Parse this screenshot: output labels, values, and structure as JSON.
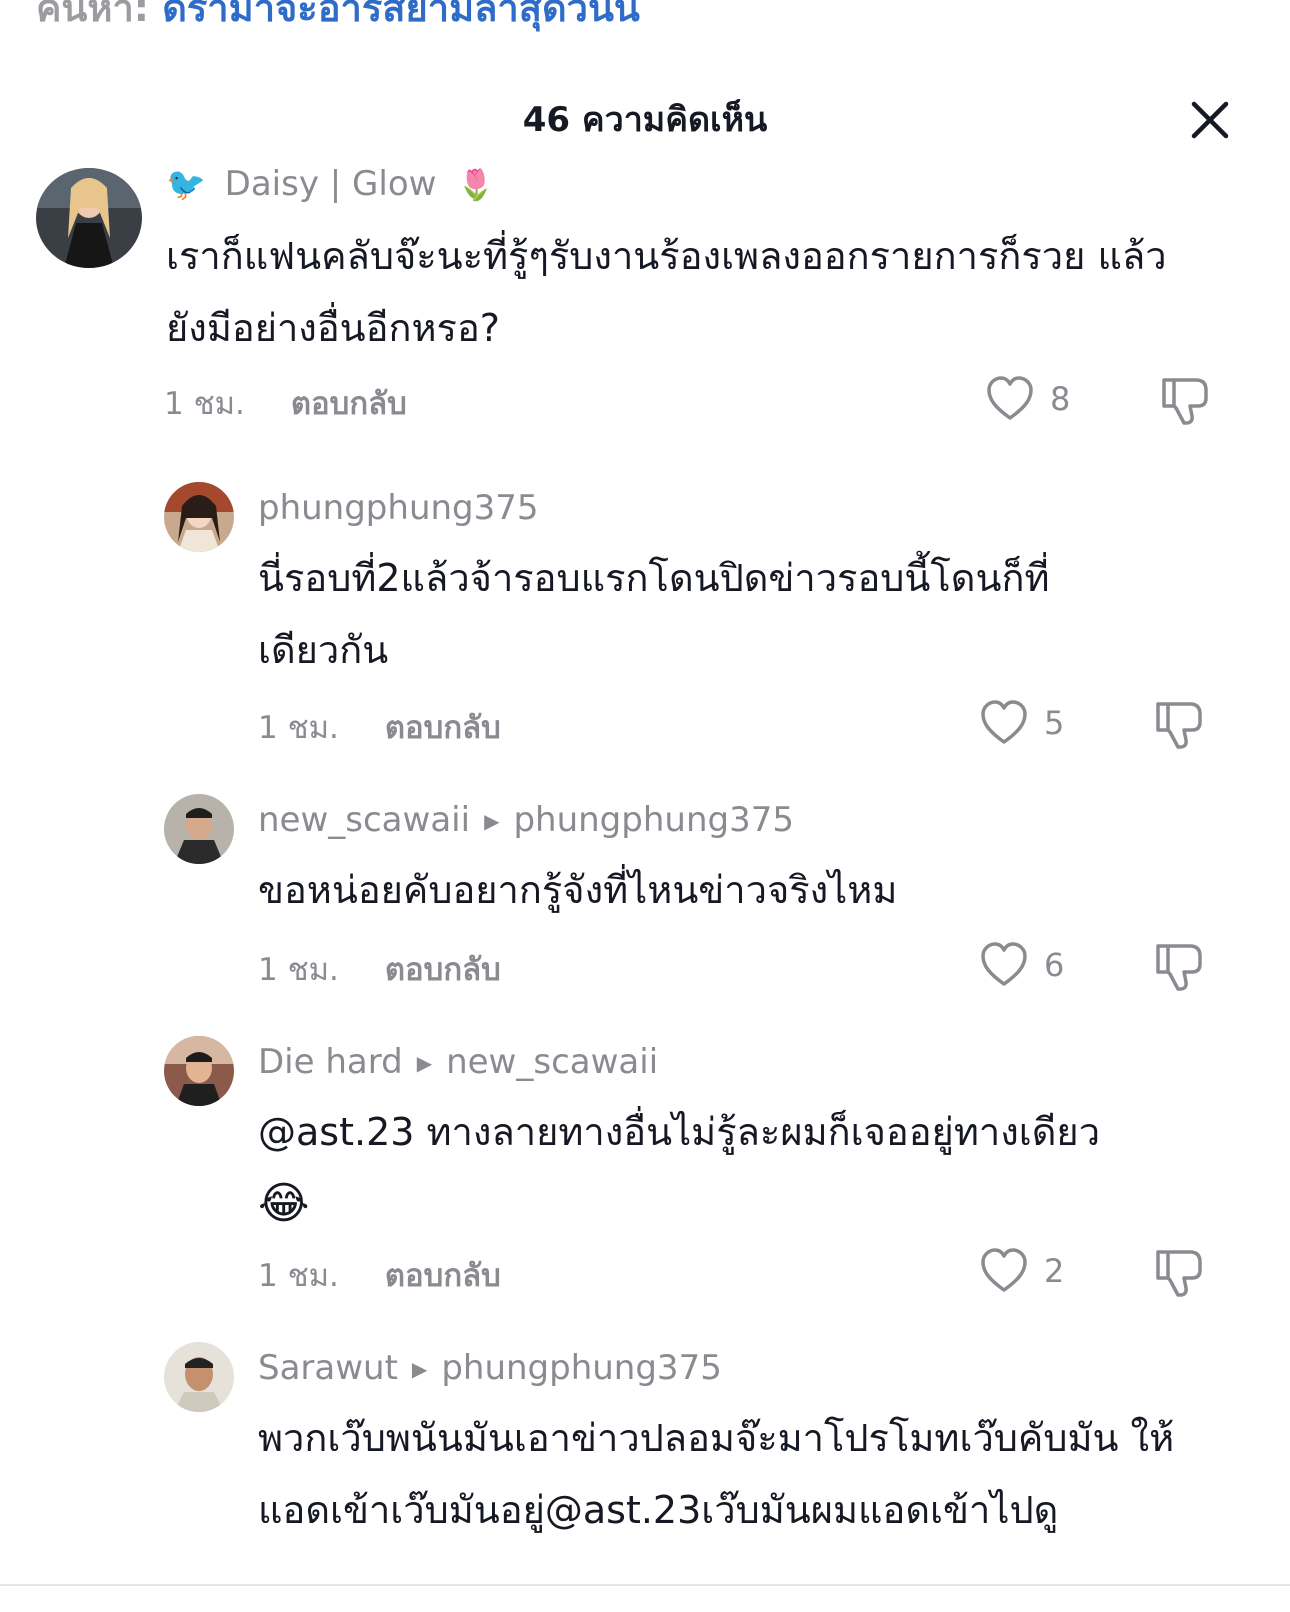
{
  "search": {
    "prefix": "ค้นหา:",
    "query": "ดราม่าจะอ้ารสยามล่าสุดวันนี้"
  },
  "header": {
    "title": "46 ความคิดเห็น"
  },
  "comments": [
    {
      "user": "Daisy | Glow",
      "reply_to": "",
      "text": "เราก็แฟนคลับจ๊ะนะที่รู้ๆรับงานร้องเพลงออกรายการก็รวย แล้วยังมีอย่างอื่นอีกหรอ?",
      "time": "1 ชม.",
      "reply_label": "ตอบกลับ",
      "likes": "8"
    },
    {
      "user": "phungphung375",
      "reply_to": "",
      "text": "นี่รอบที่2แล้วจ้ารอบแรกโดนปิดข่าวรอบนี้โดนก็ที่เดียวกัน",
      "time": "1 ชม.",
      "reply_label": "ตอบกลับ",
      "likes": "5"
    },
    {
      "user": "new_scawaii",
      "reply_to": "phungphung375",
      "text": "ขอหน่อยคับอยากรู้จังที่ไหนข่าวจริงไหม",
      "time": "1 ชม.",
      "reply_label": "ตอบกลับ",
      "likes": "6"
    },
    {
      "user": "Die hard",
      "reply_to": "new_scawaii",
      "mention": "@ast.23",
      "text": " ทางลายทางอื่นไม่รู้ละผมก็เจออยู่ทางเดียว",
      "emoji": "😂",
      "time": "1 ชม.",
      "reply_label": "ตอบกลับ",
      "likes": "2"
    },
    {
      "user": "Sarawut",
      "reply_to": "phungphung375",
      "text": "พวกเว๊บพนันมันเอาข่าวปลอมจ๊ะมาโปรโมทเว๊บคับมัน ให้แอดเข้าเว๊บมันอยู่@ast.23เว๊บมันผมแอดเข้าไปดู"
    }
  ],
  "icons": {
    "close": "close-icon",
    "like": "heart-outline-icon",
    "dislike": "thumbs-down-icon",
    "reply_arrow": "triangle-right-icon"
  },
  "colors": {
    "text": "#161823",
    "muted": "#8a8b91",
    "link": "#2f6cc8"
  }
}
